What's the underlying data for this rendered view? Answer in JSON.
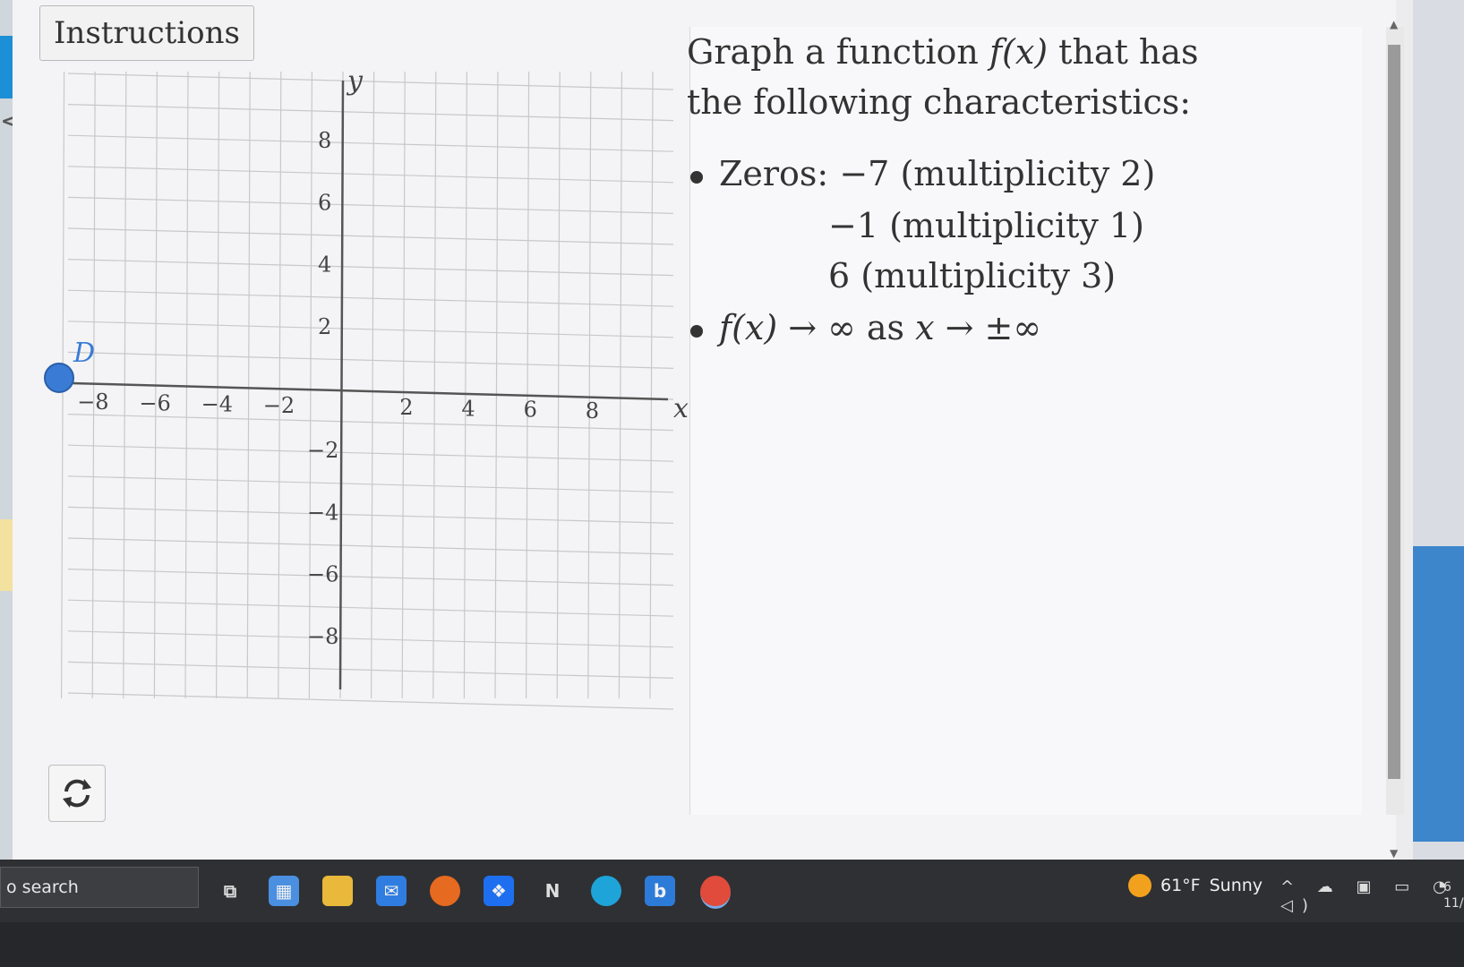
{
  "app": {
    "instructions_label": "Instructions"
  },
  "graph": {
    "y_axis_label": "y",
    "x_axis_label": "x",
    "x_ticks": [
      "-8",
      "-6",
      "-4",
      "-2",
      "2",
      "4",
      "6",
      "8"
    ],
    "y_ticks": [
      "8",
      "6",
      "4",
      "2",
      "-2",
      "-4",
      "-6",
      "-8"
    ],
    "point_label": "D"
  },
  "prompt": {
    "line1_pre": "Graph a function ",
    "line1_math": "f(x)",
    "line1_post": " that has",
    "line2": "the following characteristics:",
    "zeros_label": "Zeros:",
    "zero1_value": "−7",
    "zero1_mult": "(multiplicity 2)",
    "zero2_value": "−1",
    "zero2_mult": "(multiplicity 1)",
    "zero3_value": "6",
    "zero3_mult": "(multiplicity 3)",
    "end_behavior_fx": "f(x)",
    "end_behavior_arrow1": " → ∞ as ",
    "end_behavior_x": "x",
    "end_behavior_arrow2": " → ±∞"
  },
  "taskbar": {
    "search_placeholder": "o search",
    "weather_temp": "61°F",
    "weather_condition": "Sunny",
    "clock_time": "6",
    "clock_date": "11/"
  },
  "colors": {
    "point_fill": "#3a7bd5",
    "grid_line": "#c8c8c8",
    "axis": "#555555"
  }
}
